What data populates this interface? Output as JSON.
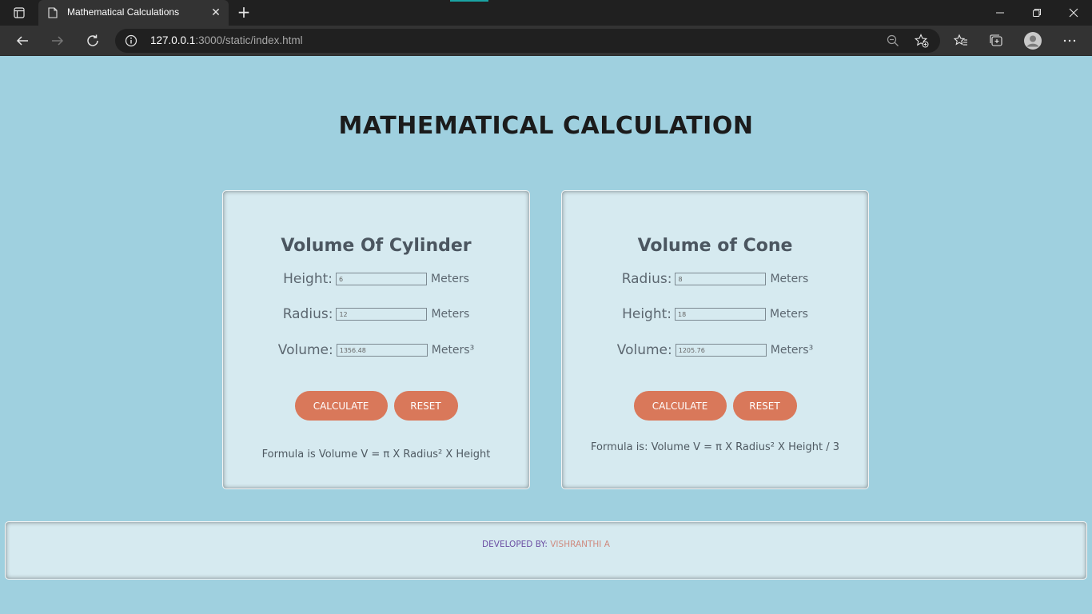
{
  "browser": {
    "tab_title": "Mathematical Calculations",
    "tab_close": "✕",
    "new_tab": "+",
    "url_host": "127.0.0.1",
    "url_path": ":3000/static/index.html"
  },
  "page": {
    "title": "MATHEMATICAL CALCULATION"
  },
  "cylinder": {
    "title": "Volume Of Cylinder",
    "height_label": "Height:",
    "height_value": "6",
    "height_unit": "Meters",
    "radius_label": "Radius:",
    "radius_value": "12",
    "radius_unit": "Meters",
    "volume_label": "Volume:",
    "volume_value": "1356.48",
    "volume_unit": "Meters³",
    "calculate_label": "CALCULATE",
    "reset_label": "RESET",
    "formula": "Formula is Volume V = π X Radius² X Height"
  },
  "cone": {
    "title": "Volume of Cone",
    "radius_label": "Radius:",
    "radius_value": "8",
    "radius_unit": "Meters",
    "height_label": "Height:",
    "height_value": "18",
    "height_unit": "Meters",
    "volume_label": "Volume:",
    "volume_value": "1205.76",
    "volume_unit": "Meters³",
    "calculate_label": "CALCULATE",
    "reset_label": "RESET",
    "formula": "Formula is: Volume V = π X Radius² X Height / 3"
  },
  "footer": {
    "label": "DEVELOPED BY:",
    "name": "VISHRANTHI A"
  },
  "colors": {
    "page_bg": "#9fd0df",
    "card_bg": "#d6eaf0",
    "button": "#d9785a",
    "footer_label": "#6b4ea2",
    "footer_name": "#cf8a7e"
  }
}
